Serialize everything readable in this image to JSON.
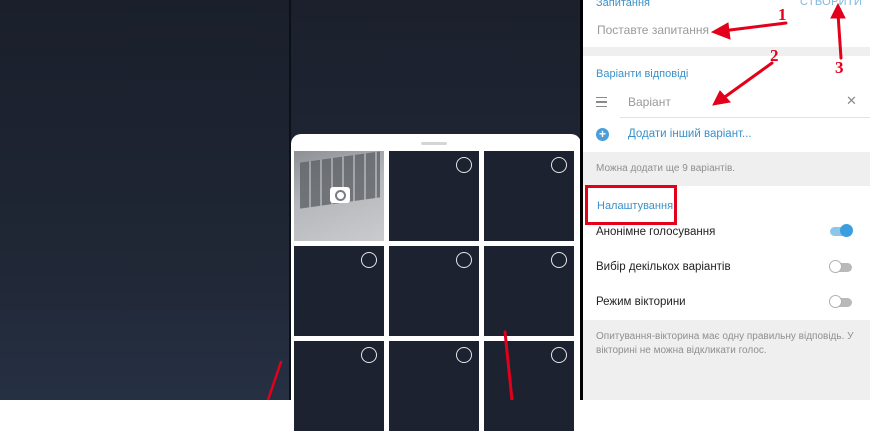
{
  "poll": {
    "question_section_title": "Запитання",
    "create_label": "СТВОРИТИ",
    "question_placeholder": "Поставте запитання",
    "answers_section_title": "Варіанти відповіді",
    "answer_placeholder": "Варіант",
    "add_option_label": "Додати інший варіант...",
    "remaining_hint": "Можна додати ще 9 варіантів.",
    "settings_title": "Налаштування",
    "settings": [
      {
        "label": "Анонімне голосування",
        "enabled": true
      },
      {
        "label": "Вибір декількох варіантів",
        "enabled": false
      },
      {
        "label": "Режим вікторини",
        "enabled": false
      }
    ],
    "quiz_hint_line1": "Опитування-вікторина має одну правильну відповідь. У",
    "quiz_hint_line2": "вікторині не можна відкликати голос."
  },
  "annotations": {
    "marker_1": "1",
    "marker_2": "2",
    "marker_3": "3",
    "color": "#e2001a"
  },
  "gallery": {
    "camera_tile_icon": "camera-icon",
    "selector_icon": "circle-select-icon"
  },
  "colors": {
    "accent": "#3a91c9",
    "toggle_on": "#3b9ede",
    "highlight": "#e2001a"
  }
}
